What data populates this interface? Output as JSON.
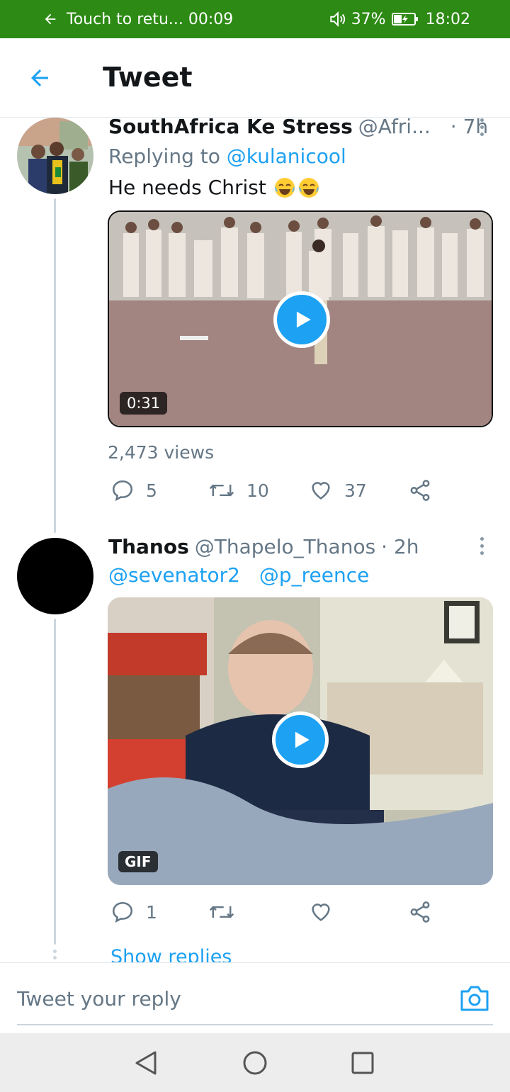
{
  "status_bar": {
    "return_call": "Touch to retu... 00:09",
    "battery_percent": "37%",
    "clock": "18:02",
    "bg_color": "#2d8a14"
  },
  "header": {
    "back_icon": "arrow-left-icon",
    "title": "Tweet",
    "accent": "#1da1f2"
  },
  "tweets": [
    {
      "name": "SouthAfrica Ke Stress",
      "handle": "@Afri...",
      "time": "· 7h",
      "replying_prefix": "Replying to ",
      "replying_to": "@kulanicool",
      "text": "He needs Christ",
      "emoji": [
        "face-with-tears-of-joy",
        "face-with-tears-of-joy"
      ],
      "media": {
        "type": "video",
        "duration": "0:31"
      },
      "views": "2,473 views",
      "replies": "5",
      "retweets": "10",
      "likes": "37"
    },
    {
      "name": "Thanos",
      "handle": "@Thapelo_Thanos",
      "time": "· 2h",
      "mentions": [
        "@sevenator2",
        "@p_reence"
      ],
      "media": {
        "type": "gif",
        "badge": "GIF"
      },
      "replies": "1",
      "retweets": "",
      "likes": "",
      "show_replies": "Show replies"
    }
  ],
  "composer": {
    "placeholder": "Tweet your reply",
    "camera_icon": "camera-icon"
  },
  "nav_bar": {
    "back": "triangle-back-icon",
    "home": "circle-home-icon",
    "recents": "square-recents-icon"
  }
}
